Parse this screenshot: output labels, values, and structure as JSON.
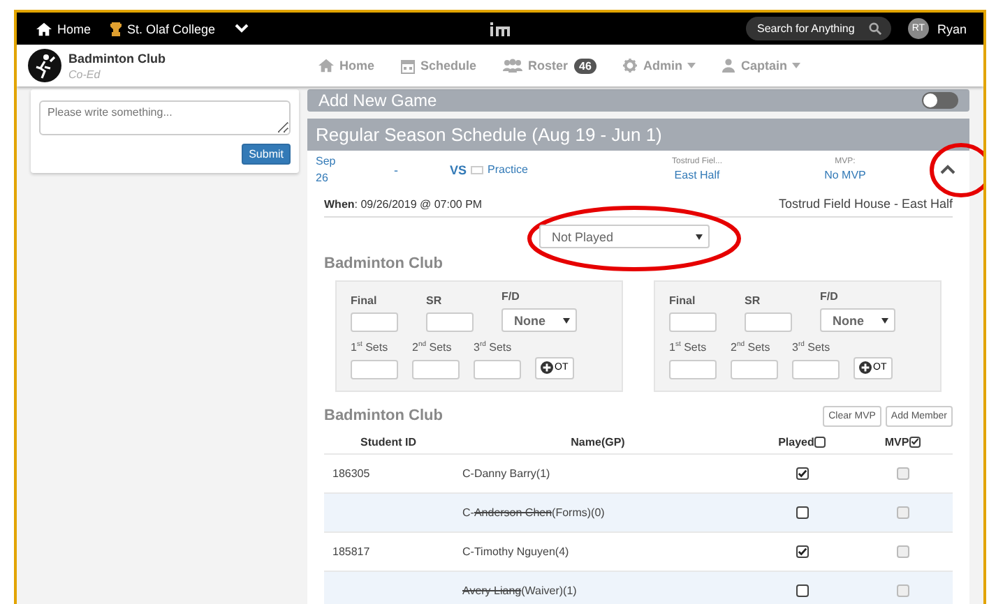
{
  "topbar": {
    "home": "Home",
    "school": "St. Olaf College",
    "search": {
      "placeholder": "Search for Anything"
    },
    "user": {
      "initials": "RT",
      "name": "Ryan"
    }
  },
  "club": {
    "name": "Badminton Club",
    "subtitle": "Co-Ed"
  },
  "nav": [
    {
      "kind": "home",
      "label": "Home",
      "dropdown": false
    },
    {
      "kind": "schedule",
      "label": "Schedule",
      "dropdown": false
    },
    {
      "kind": "roster",
      "label": "Roster",
      "badge": "46",
      "dropdown": false
    },
    {
      "kind": "admin",
      "label": "Admin",
      "dropdown": true
    },
    {
      "kind": "captain",
      "label": "Captain",
      "dropdown": true
    }
  ],
  "post": {
    "placeholder": "Please write something...",
    "button": "Submit"
  },
  "add_game": {
    "title": "Add New Game",
    "on": false
  },
  "schedule": {
    "title": "Regular Season Schedule (Aug 19 - Jun 1)",
    "game": {
      "month": "Sep",
      "day": "26",
      "score": "-",
      "vs": "VS",
      "opponent": "Practice",
      "location_label": "Tostrud Fiel...",
      "location": "East Half",
      "mvp_label": "MVP:",
      "mvp": "No MVP",
      "expanded": true
    },
    "when_label": "When",
    "when": ": 09/26/2019 @ 07:00 PM",
    "venue": "Tostrud Field House - East Half",
    "status": "Not Played",
    "team_title": "Badminton Club",
    "score_boxes": [
      {
        "final_label": "Final",
        "sr_label": "SR",
        "fd_label": "F/D",
        "fd": "None",
        "sets": [
          "1$^{st}$ Sets",
          "2$^{nd}$ Sets",
          "3$^{rd}$ Sets"
        ],
        "ot": "OT"
      },
      {
        "final_label": "Final",
        "sr_label": "SR",
        "fd_label": "F/D",
        "fd": "None",
        "sets": [
          "1$^{st}$ Sets",
          "2$^{nd}$ Sets",
          "3$^{rd}$ Sets"
        ],
        "ot": "OT"
      }
    ],
    "roster_title": "Badminton Club",
    "buttons": [
      "Clear MVP",
      "Add Member"
    ],
    "columns": [
      {
        "label": "Student ID"
      },
      {
        "label": "Name(GP)"
      },
      {
        "label": "Played",
        "checked": false
      },
      {
        "label": "MVP",
        "checked": true
      }
    ],
    "rows": [
      {
        "student_id": "186305",
        "prefix": "C-",
        "player": "Danny Barry",
        "note": "(1)",
        "removed": false,
        "played": true,
        "mvp": false
      },
      {
        "prefix": "C-",
        "player": "Anderson Chen",
        "note": "(Forms)(0)",
        "removed": true,
        "played": false,
        "mvp": false
      },
      {
        "student_id": "185817",
        "prefix": "C-",
        "player": "Timothy Nguyen",
        "note": "(4)",
        "removed": false,
        "played": true,
        "mvp": false
      },
      {
        "player": "Avery Liang",
        "note": "(Waiver)(1)",
        "removed": true,
        "played": false,
        "mvp": false
      }
    ]
  }
}
